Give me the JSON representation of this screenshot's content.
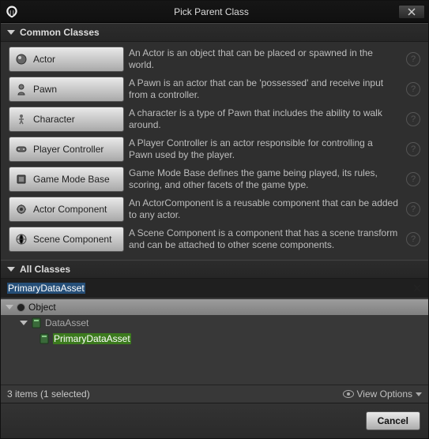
{
  "window": {
    "title": "Pick Parent Class"
  },
  "sections": {
    "common_label": "Common Classes",
    "all_label": "All Classes"
  },
  "common": [
    {
      "label": "Actor",
      "desc": "An Actor is an object that can be placed or spawned in the world.",
      "icon": "actor-icon"
    },
    {
      "label": "Pawn",
      "desc": "A Pawn is an actor that can be 'possessed' and receive input from a controller.",
      "icon": "pawn-icon"
    },
    {
      "label": "Character",
      "desc": "A character is a type of Pawn that includes the ability to walk around.",
      "icon": "character-icon"
    },
    {
      "label": "Player Controller",
      "desc": "A Player Controller is an actor responsible for controlling a Pawn used by the player.",
      "icon": "controller-icon"
    },
    {
      "label": "Game Mode Base",
      "desc": "Game Mode Base defines the game being played, its rules, scoring, and other facets of the game type.",
      "icon": "gamemode-icon"
    },
    {
      "label": "Actor Component",
      "desc": "An ActorComponent is a reusable component that can be added to any actor.",
      "icon": "actor-component-icon"
    },
    {
      "label": "Scene Component",
      "desc": "A Scene Component is a component that has a scene transform and can be attached to other scene components.",
      "icon": "scene-component-icon"
    }
  ],
  "search": {
    "value": "PrimaryDataAsset"
  },
  "tree": {
    "root": "Object",
    "child": "DataAsset",
    "grandchild": "PrimaryDataAsset"
  },
  "status": {
    "text": "3 items (1 selected)",
    "view_options": "View Options"
  },
  "footer": {
    "cancel": "Cancel"
  }
}
